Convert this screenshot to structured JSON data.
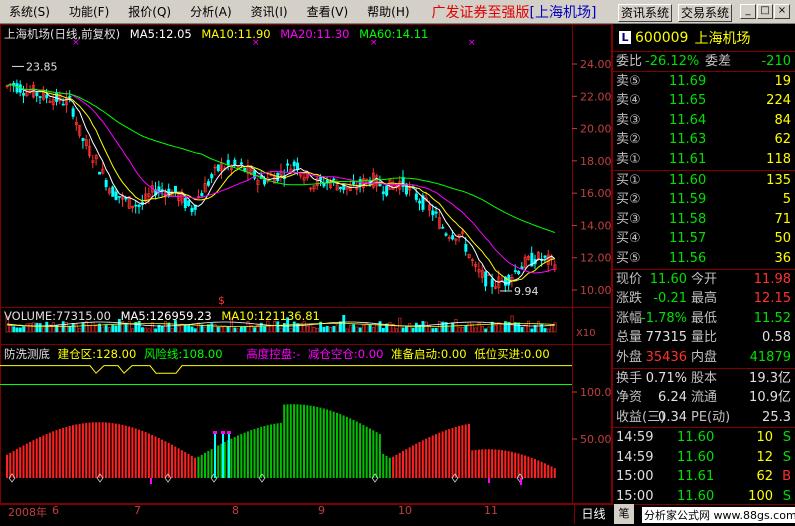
{
  "menu": [
    "系统(S)",
    "功能(F)",
    "报价(Q)",
    "分析(A)",
    "资讯(I)",
    "查看(V)",
    "帮助(H)"
  ],
  "app_title": "广发证券至强版",
  "app_sub": "[上海机场]",
  "buttons": {
    "info": "资讯系统",
    "trade": "交易系统"
  },
  "window_controls": [
    "_",
    "□",
    "×"
  ],
  "main_header": {
    "title": "上海机场(日线,前复权)",
    "ma5": "MA5:12.05",
    "ma10": "MA10:11.90",
    "ma20": "MA20:11.30",
    "ma60": "MA60:14.11"
  },
  "price_axis": [
    "24.00",
    "22.00",
    "20.00",
    "18.00",
    "16.00",
    "14.00",
    "12.00",
    "10.00"
  ],
  "high_label": "23.85",
  "low_label": "9.94",
  "volume_header": {
    "vol": "VOLUME:77315.00",
    "ma5": "MA5:126959.23",
    "ma10": "MA10:121136.81"
  },
  "volume_unit": "X10",
  "indicator_header": {
    "name": "防洗测底",
    "jian": "建仓区:128.00",
    "feng": "风险线:108.00",
    "gao": "高度控盘:-",
    "jian2": "减仓空仓:0.00",
    "zhun": "准备启动:0.00",
    "di": "低位买进:0.00"
  },
  "indicator_axis": [
    "100.0",
    "50.00"
  ],
  "x_axis": [
    {
      "label": "2008年",
      "pos": 8
    },
    {
      "label": "6",
      "pos": 52
    },
    {
      "label": "7",
      "pos": 134
    },
    {
      "label": "8",
      "pos": 232
    },
    {
      "label": "9",
      "pos": 318
    },
    {
      "label": "10",
      "pos": 398
    },
    {
      "label": "11",
      "pos": 484
    }
  ],
  "period": "日线",
  "pen": "笔",
  "watermark": "分析家公式网 www.88gs.com",
  "stock": {
    "code": "600009",
    "name": "上海机场"
  },
  "weibi": {
    "label": "委比",
    "pct": "-26.12%",
    "label2": "委差",
    "diff": "-210"
  },
  "sell": [
    {
      "label": "卖⑤",
      "price": "11.69",
      "vol": "19"
    },
    {
      "label": "卖④",
      "price": "11.65",
      "vol": "224"
    },
    {
      "label": "卖③",
      "price": "11.64",
      "vol": "84"
    },
    {
      "label": "卖②",
      "price": "11.63",
      "vol": "62"
    },
    {
      "label": "卖①",
      "price": "11.61",
      "vol": "118"
    }
  ],
  "buy": [
    {
      "label": "买①",
      "price": "11.60",
      "vol": "135"
    },
    {
      "label": "买②",
      "price": "11.59",
      "vol": "5"
    },
    {
      "label": "买③",
      "price": "11.58",
      "vol": "71"
    },
    {
      "label": "买④",
      "price": "11.57",
      "vol": "50"
    },
    {
      "label": "买⑤",
      "price": "11.56",
      "vol": "36"
    }
  ],
  "quote": [
    {
      "l1": "现价",
      "v1": "11.60",
      "c1": "green",
      "l2": "今开",
      "v2": "11.98",
      "c2": "red"
    },
    {
      "l1": "涨跌",
      "v1": "-0.21",
      "c1": "green",
      "l2": "最高",
      "v2": "12.15",
      "c2": "red"
    },
    {
      "l1": "涨幅",
      "v1": "-1.78%",
      "c1": "green",
      "l2": "最低",
      "v2": "11.52",
      "c2": "green"
    },
    {
      "l1": "总量",
      "v1": "77315",
      "c1": "white",
      "l2": "量比",
      "v2": "0.58",
      "c2": "white"
    },
    {
      "l1": "外盘",
      "v1": "35436",
      "c1": "red",
      "l2": "内盘",
      "v2": "41879",
      "c2": "green"
    }
  ],
  "fund": [
    {
      "l1": "换手",
      "v1": "0.71%",
      "l2": "股本",
      "v2": "19.3亿"
    },
    {
      "l1": "净资",
      "v1": "6.24",
      "l2": "流通",
      "v2": "10.9亿"
    },
    {
      "l1": "收益(三)",
      "v1": "0.34",
      "l2": "PE(动)",
      "v2": "25.3"
    }
  ],
  "ticks": [
    {
      "time": "14:59",
      "price": "11.60",
      "vol": "10",
      "side": "S"
    },
    {
      "time": "14:59",
      "price": "11.60",
      "vol": "12",
      "side": "S"
    },
    {
      "time": "15:00",
      "price": "11.61",
      "vol": "62",
      "side": "B"
    },
    {
      "time": "15:00",
      "price": "11.60",
      "vol": "100",
      "side": "S"
    }
  ],
  "colors": {
    "up": "#ff3030",
    "down": "#00ffff",
    "ma5": "#ffffff",
    "ma10": "#ffff00",
    "ma20": "#ff00ff",
    "ma60": "#00ff00",
    "ind_red": "#ff2020",
    "ind_green": "#00c000"
  }
}
